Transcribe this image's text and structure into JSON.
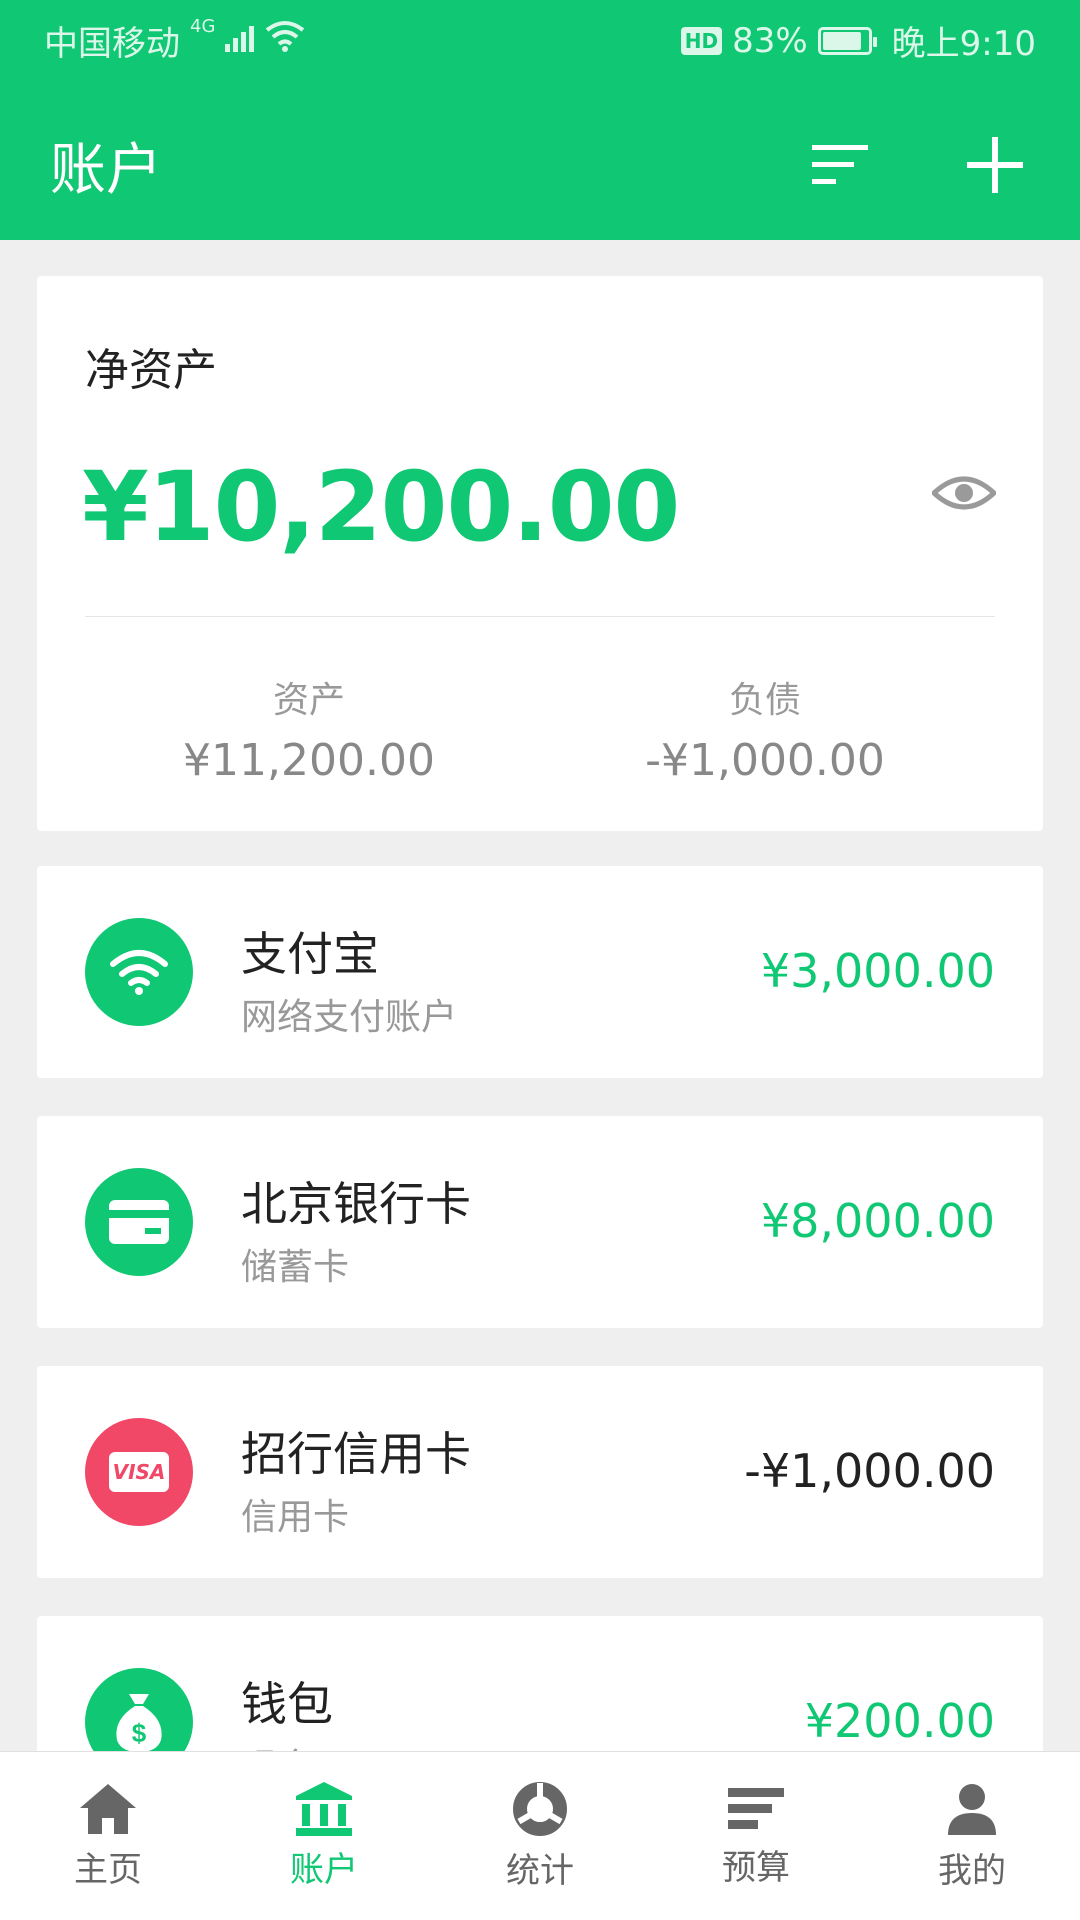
{
  "colors": {
    "brand": "#10c774",
    "negative_icon": "#f04866",
    "text_dark": "#222222",
    "text_muted": "#999999",
    "background": "#efefef"
  },
  "status_bar": {
    "carrier": "中国移动",
    "network": "4G",
    "hd": "HD",
    "battery": "83%",
    "time": "晚上9:10"
  },
  "app_bar": {
    "title": "账户",
    "sort_icon": "sort-icon",
    "add_icon": "plus-icon"
  },
  "net_assets": {
    "title": "净资产",
    "amount": "¥10,200.00",
    "eye_icon": "eye-icon",
    "assets_label": "资产",
    "assets_value": "¥11,200.00",
    "liabilities_label": "负债",
    "liabilities_value": "-¥1,000.00"
  },
  "accounts": [
    {
      "name": "支付宝",
      "type": "网络支付账户",
      "balance": "¥3,000.00",
      "icon": "wifi-icon",
      "icon_color": "#10c774"
    },
    {
      "name": "北京银行卡",
      "type": "储蓄卡",
      "balance": "¥8,000.00",
      "icon": "card-icon",
      "icon_color": "#10c774"
    },
    {
      "name": "招行信用卡",
      "type": "信用卡",
      "balance": "-¥1,000.00",
      "icon": "visa-icon",
      "icon_color": "#f04866",
      "icon_text": "VISA"
    },
    {
      "name": "钱包",
      "type": "现金",
      "balance": "¥200.00",
      "icon": "money-bag-icon",
      "icon_color": "#10c774"
    }
  ],
  "bottom_nav": [
    {
      "label": "主页",
      "icon": "home-icon",
      "active": false
    },
    {
      "label": "账户",
      "icon": "bank-icon",
      "active": true
    },
    {
      "label": "统计",
      "icon": "stats-icon",
      "active": false
    },
    {
      "label": "预算",
      "icon": "budget-icon",
      "active": false
    },
    {
      "label": "我的",
      "icon": "user-icon",
      "active": false
    }
  ]
}
